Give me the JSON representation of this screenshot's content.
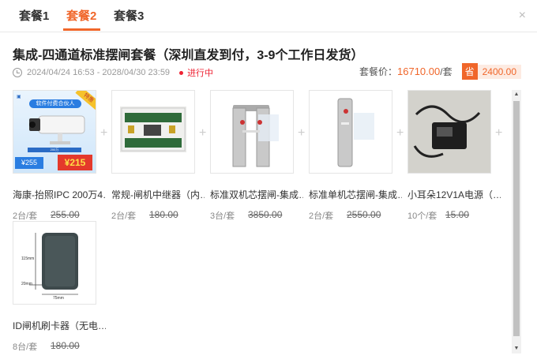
{
  "tabs": [
    {
      "label": "套餐1"
    },
    {
      "label": "套餐2"
    },
    {
      "label": "套餐3"
    }
  ],
  "close_label": "×",
  "package": {
    "title": "集成-四通道标准摆闸套餐（深圳直发到付，3-9个工作日发货）",
    "time_range": "2024/04/24 16:53 - 2028/04/30 23:59",
    "status": "进行中",
    "price_label": "套餐价：",
    "price": "16710.00",
    "price_unit": "/套",
    "save_tag": "省",
    "save_amount": "2400.00"
  },
  "plus_sign": "+",
  "items": [
    {
      "name": "海康-抬照IPC 200万4…",
      "qty": "2台/套",
      "orig": "255.00",
      "img_text1": "软件付费合伙人",
      "img_text2": "¥255",
      "img_text3": "¥215",
      "img_text4": "特惠"
    },
    {
      "name": "常规-闸机中继器（内…",
      "qty": "2台/套",
      "orig": "180.00"
    },
    {
      "name": "标准双机芯摆闸-集成…",
      "qty": "3台/套",
      "orig": "3850.00"
    },
    {
      "name": "标准单机芯摆闸-集成…",
      "qty": "2台/套",
      "orig": "2550.00"
    },
    {
      "name": "小耳朵12V1A电源（…",
      "qty": "10个/套",
      "orig": "15.00"
    },
    {
      "name": "ID闸机刷卡器（无电…",
      "qty": "8台/套",
      "orig": "180.00",
      "dim1": "115mm",
      "dim2": "20mm",
      "dim3": "75mm"
    }
  ],
  "scrollbar": {
    "up": "▲",
    "down": "▼"
  },
  "colors": {
    "accent": "#f0662a",
    "status": "#e23333"
  }
}
